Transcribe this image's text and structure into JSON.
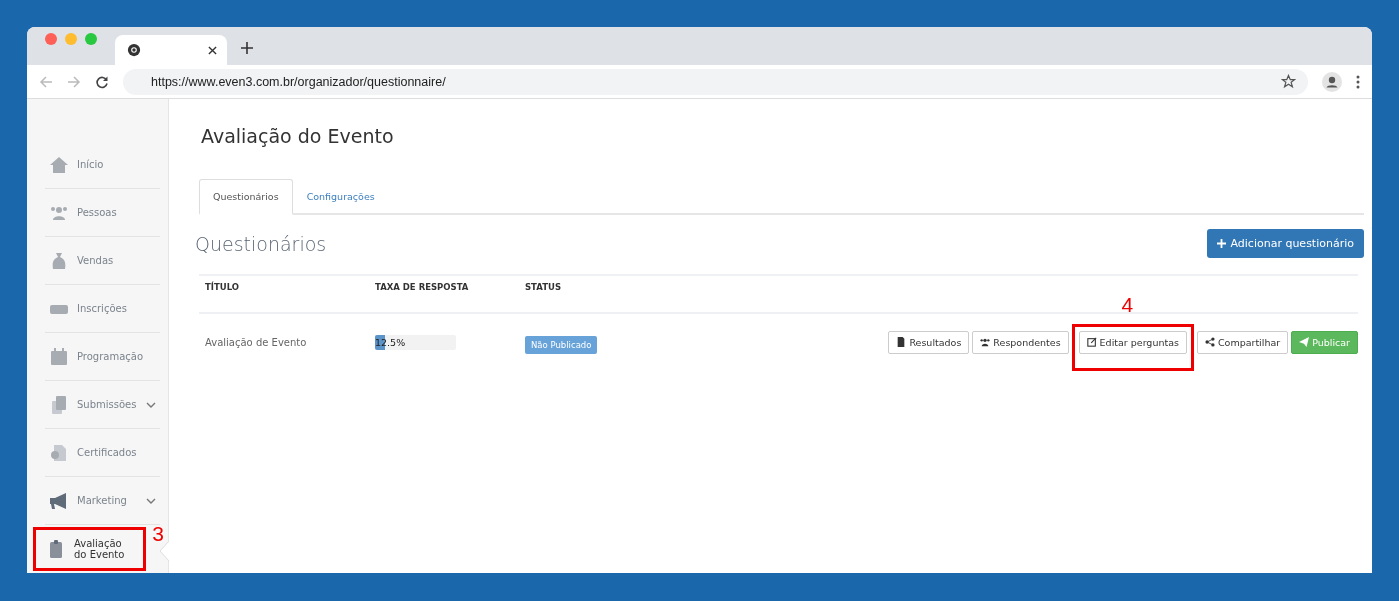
{
  "browser": {
    "url": "https://www.even3.com.br/organizador/questionnaire/"
  },
  "sidebar": {
    "items": [
      {
        "label": "Início",
        "selected": false,
        "expandable": false
      },
      {
        "label": "Pessoas",
        "selected": false,
        "expandable": false
      },
      {
        "label": "Vendas",
        "selected": false,
        "expandable": false
      },
      {
        "label": "Inscrições",
        "selected": false,
        "expandable": false
      },
      {
        "label": "Programação",
        "selected": false,
        "expandable": false
      },
      {
        "label": "Submissões",
        "selected": false,
        "expandable": true
      },
      {
        "label": "Certificados",
        "selected": false,
        "expandable": false
      },
      {
        "label": "Marketing",
        "selected": false,
        "expandable": true
      },
      {
        "label": "Avaliação do Evento",
        "selected": true,
        "expandable": false,
        "annotation": "3"
      }
    ]
  },
  "page": {
    "title": "Avaliação do Evento",
    "tabs": [
      {
        "label": "Questionários",
        "selected": true
      },
      {
        "label": "Configurações",
        "selected": false
      }
    ],
    "section_title": "Questionários",
    "add_button": "Adicionar questionário",
    "table": {
      "columns": [
        "TÍTULO",
        "TAXA DE RESPOSTA",
        "STATUS"
      ],
      "rows": [
        {
          "title": "Avaliação de Evento",
          "rate": {
            "level": 0.125,
            "reading": "12.5%"
          },
          "status": "Não Publicado",
          "actions": [
            {
              "label": "Resultados",
              "kind": "default"
            },
            {
              "label": "Respondentes",
              "kind": "default"
            },
            {
              "label": "Editar perguntas",
              "kind": "default",
              "annotation": "4"
            },
            {
              "label": "Compartilhar",
              "kind": "default"
            },
            {
              "label": "Publicar",
              "kind": "success"
            }
          ]
        }
      ]
    }
  }
}
